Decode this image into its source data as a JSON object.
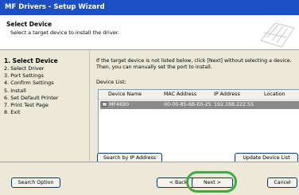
{
  "window": {
    "title": "MF Drivers - Setup Wizard"
  },
  "header": {
    "title": "Select Device",
    "subtitle": "Select a target device to install the driver."
  },
  "steps": [
    {
      "label": "1.  Select Device",
      "active": true
    },
    {
      "label": "2.  Select Driver"
    },
    {
      "label": "3.  Port Settings"
    },
    {
      "label": "4.  Confirm Settings"
    },
    {
      "label": "5.  Install"
    },
    {
      "label": "6.  Set Default Printer"
    },
    {
      "label": "7.  Print Test Page"
    },
    {
      "label": "8.  Exit"
    }
  ],
  "main": {
    "instructions": "If the target device is not listed below, click [Next] without selecting a device. Then, you can manually set the port to install.",
    "device_list_label": "Device List:",
    "columns": [
      "Device Name",
      "MAC Address",
      "IP Address",
      "Location"
    ],
    "rows": [
      {
        "device_name": "MF4690",
        "mac_address": "00-00-85-6B-E0-25",
        "ip_address": "192.168.222.55",
        "location": ""
      }
    ],
    "search_ip_button": "Search by IP Address",
    "update_list_button": "Update Device List"
  },
  "footer": {
    "search_option_button": "Search Option",
    "back_button": "< Back",
    "next_button": "Next >",
    "cancel_button": "Cancel"
  },
  "colors": {
    "titlebar": "#1c4fc5",
    "selected_row": "#8a8a8a",
    "highlight_ring": "#3cae3c"
  }
}
